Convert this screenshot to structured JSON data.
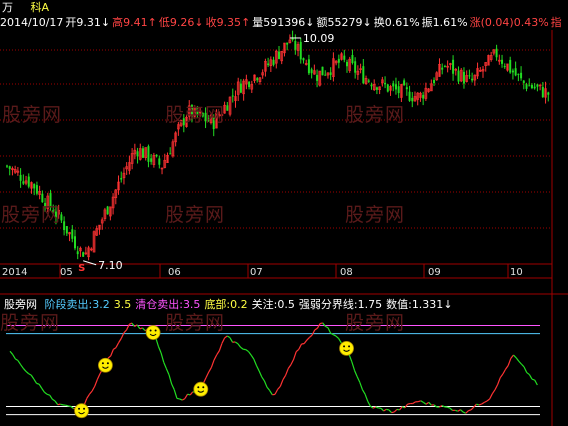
{
  "header": {
    "symbol": "万",
    "name": "科A",
    "items": [
      {
        "label": "2014/10/17",
        "value": "",
        "arrow": "",
        "color": "#ffffff"
      },
      {
        "label": "开",
        "value": "9.31",
        "arrow": "↓",
        "color": "#ffffff"
      },
      {
        "label": "高",
        "value": "9.41",
        "arrow": "↑",
        "color": "#ff4444"
      },
      {
        "label": "低",
        "value": "9.26",
        "arrow": "↓",
        "color": "#ff4444"
      },
      {
        "label": "收",
        "value": "9.35",
        "arrow": "↑",
        "color": "#ff4444"
      },
      {
        "label": "量",
        "value": "591396",
        "arrow": "↓",
        "color": "#ffffff"
      },
      {
        "label": "额",
        "value": "55279",
        "arrow": "↓",
        "color": "#ffffff"
      },
      {
        "label": "换",
        "value": "0.61%",
        "arrow": "",
        "color": "#ffffff"
      },
      {
        "label": "振",
        "value": "1.61%",
        "arrow": "",
        "color": "#ffffff"
      },
      {
        "label": "涨",
        "value": "(0.04)0.43%",
        "arrow": "",
        "color": "#ff4444"
      },
      {
        "label": "指",
        "value": "",
        "arrow": "",
        "color": "#ff4444"
      }
    ]
  },
  "indicator_header": {
    "name": "股旁网",
    "items": [
      {
        "label": "阶段卖出:",
        "value": "3.2",
        "color": "#55ccff"
      },
      {
        "label": "",
        "value": "3.5",
        "color": "#ffff44"
      },
      {
        "label": "清仓卖出:",
        "value": "3.5",
        "color": "#ff55ff"
      },
      {
        "label": "底部:",
        "value": "0.2",
        "color": "#ffff44"
      },
      {
        "label": "关注:",
        "value": "0.5",
        "color": "#ffffff"
      },
      {
        "label": "强弱分界线:",
        "value": "1.75",
        "color": "#ffffff"
      },
      {
        "label": "数值:",
        "value": "1.331",
        "color": "#ffffff",
        "arrow": "↓"
      }
    ]
  },
  "watermark": "股旁网",
  "colors": {
    "up": "#ff3333",
    "down": "#22dd22",
    "grid": "#a00000",
    "label": "#e0e0e0",
    "sell_line": "#ff55ff",
    "stage_line": "#55ccff",
    "base_line": "#ffffff",
    "smiley": "#ffee00"
  },
  "annotations": {
    "high": "10.09",
    "low": "7.10",
    "low_marker": "S"
  },
  "chart_data": [
    {
      "type": "candlestick",
      "x_ticks": [
        "2014",
        "05",
        "06",
        "07",
        "08",
        "09",
        "10"
      ],
      "ylim": [
        7.0,
        10.2
      ],
      "grid": true,
      "price_ends": [
        8.35,
        8.1,
        7.65,
        7.1,
        7.85,
        8.6,
        8.35,
        9.1,
        8.95,
        9.45,
        9.7,
        10.09,
        9.6,
        9.8,
        9.55,
        9.4,
        9.3,
        9.75,
        9.5,
        9.9,
        9.5,
        9.35
      ],
      "price_points": 200,
      "max_close": 10.09,
      "min_close": 7.1
    },
    {
      "type": "line",
      "name": "股旁网",
      "ylim": [
        0,
        4
      ],
      "levels": [
        3.5,
        3.2,
        0.5,
        0.2
      ],
      "ends": [
        2.5,
        1.5,
        0.55,
        0.4,
        2.1,
        3.6,
        3.2,
        0.7,
        1.2,
        3.1,
        2.5,
        0.8,
        2.6,
        3.6,
        2.7,
        0.5,
        0.3,
        0.7,
        0.5,
        0.3,
        0.8,
        2.4,
        1.3
      ],
      "points": 200,
      "signals": [
        3,
        4,
        6,
        8,
        14
      ]
    }
  ]
}
